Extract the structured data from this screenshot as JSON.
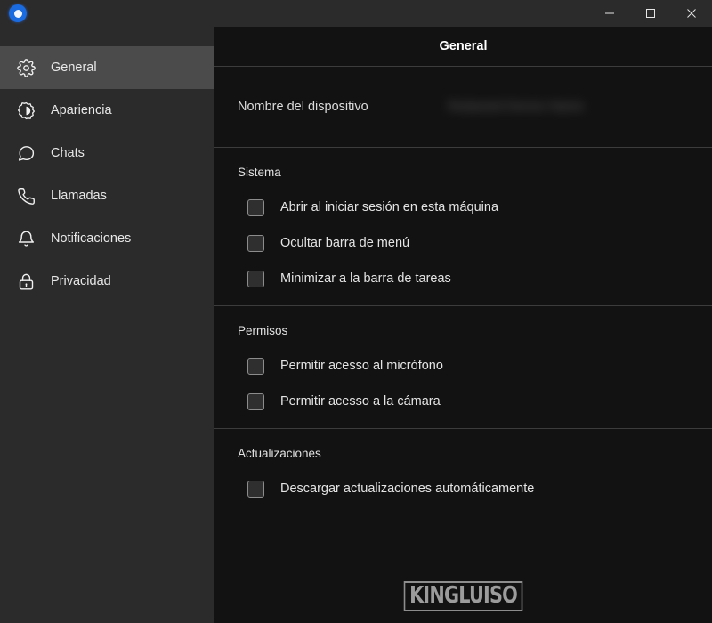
{
  "window": {
    "logo_icon": "app-logo-circle-icon",
    "controls": [
      {
        "name": "minimize",
        "icon": "minimize-icon",
        "label": "—"
      },
      {
        "name": "maximize",
        "icon": "maximize-icon",
        "label": "□"
      },
      {
        "name": "close",
        "icon": "close-icon",
        "label": "✕"
      }
    ]
  },
  "sidebar": {
    "items": [
      {
        "label": "General",
        "icon": "gear-icon",
        "active": true
      },
      {
        "label": "Apariencia",
        "icon": "brightness-icon",
        "active": false
      },
      {
        "label": "Chats",
        "icon": "chat-bubble-icon",
        "active": false
      },
      {
        "label": "Llamadas",
        "icon": "phone-icon",
        "active": false
      },
      {
        "label": "Notificaciones",
        "icon": "bell-icon",
        "active": false
      },
      {
        "label": "Privacidad",
        "icon": "lock-icon",
        "active": false
      }
    ]
  },
  "main": {
    "header_title": "General",
    "device": {
      "label": "Nombre del dispositivo",
      "value": "Redacted Device Name",
      "redacted": true
    },
    "sections": [
      {
        "title": "Sistema",
        "options": [
          {
            "label": "Abrir al iniciar sesión en esta máquina",
            "checked": false
          },
          {
            "label": "Ocultar barra de menú",
            "checked": false
          },
          {
            "label": "Minimizar a la barra de tareas",
            "checked": false
          }
        ]
      },
      {
        "title": "Permisos",
        "options": [
          {
            "label": "Permitir acesso al micrófono",
            "checked": false
          },
          {
            "label": "Permitir acesso a la cámara",
            "checked": false
          }
        ]
      },
      {
        "title": "Actualizaciones",
        "options": [
          {
            "label": "Descargar actualizaciones automáticamente",
            "checked": false
          }
        ]
      }
    ]
  },
  "watermark": {
    "text": "KINGLUISO"
  },
  "colors": {
    "titlebar_bg": "#2b2b2b",
    "sidebar_bg": "#2b2b2b",
    "sidebar_active_bg": "#4b4b4b",
    "main_bg": "#121212",
    "divider": "#3c3c3c",
    "accent_logo": "#1a6ae0",
    "text_primary": "#e8e8e8"
  }
}
